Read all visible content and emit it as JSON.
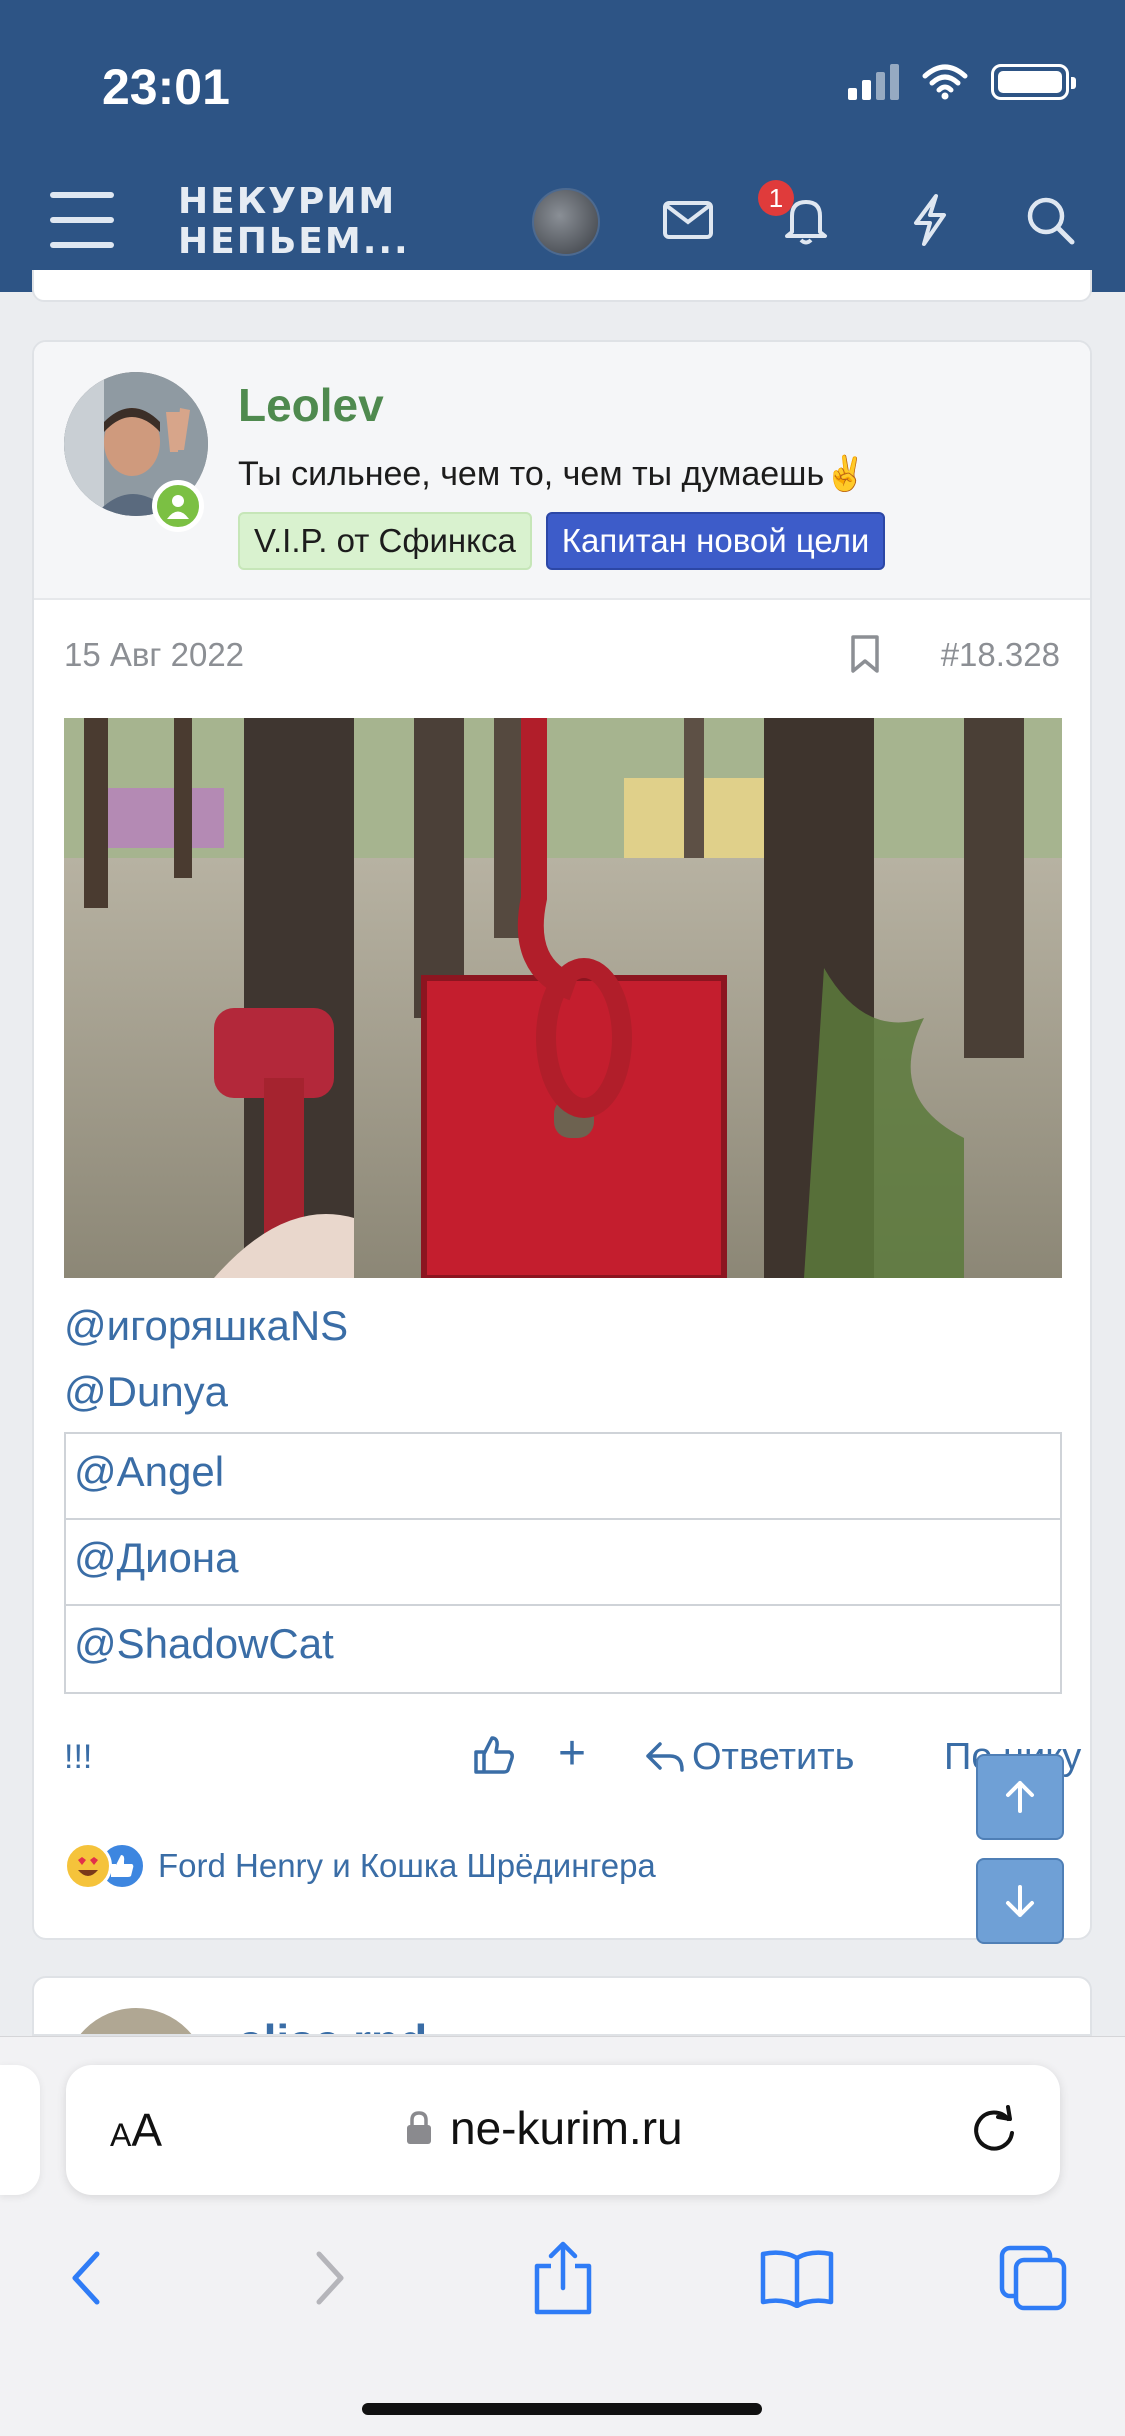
{
  "status_bar": {
    "time": "23:01"
  },
  "header": {
    "logo_line1": "НЕКУРИМ",
    "logo_line2": "НЕПЬЕМ...",
    "notifications_count": "1",
    "bg_color": "#2d5485"
  },
  "post": {
    "author": "Leolev",
    "author_title": "Ты сильнее, чем то, чем ты думаешь✌️",
    "tags": [
      "V.I.P. от Сфинкса",
      "Капитан новой цели"
    ],
    "date": "15 Авг 2022",
    "post_number": "#18.328",
    "mentions_inline": [
      "@игоряшкаNS",
      "@Dunya"
    ],
    "mentions_table": [
      "@Angel",
      "@Диона",
      "@ShadowCat"
    ],
    "footer": {
      "exclaim": "!!!",
      "plus": "+",
      "reply": "Ответить",
      "by_nick": "По нику"
    },
    "reactions_text": "Ford Henry и Кошка Шрёдингера"
  },
  "next_post": {
    "author": "alisa.rnd"
  },
  "browser": {
    "aa_label": "AA",
    "url": "ne-kurim.ru"
  },
  "icons": [
    "menu-icon",
    "mail-icon",
    "bell-icon",
    "lightning-icon",
    "search-icon",
    "bookmark-icon",
    "like-icon",
    "reply-icon",
    "arrow-up-icon",
    "arrow-down-icon",
    "lock-icon",
    "reload-icon",
    "back-icon",
    "forward-icon",
    "share-icon",
    "bookmarks-icon",
    "tabs-icon"
  ]
}
